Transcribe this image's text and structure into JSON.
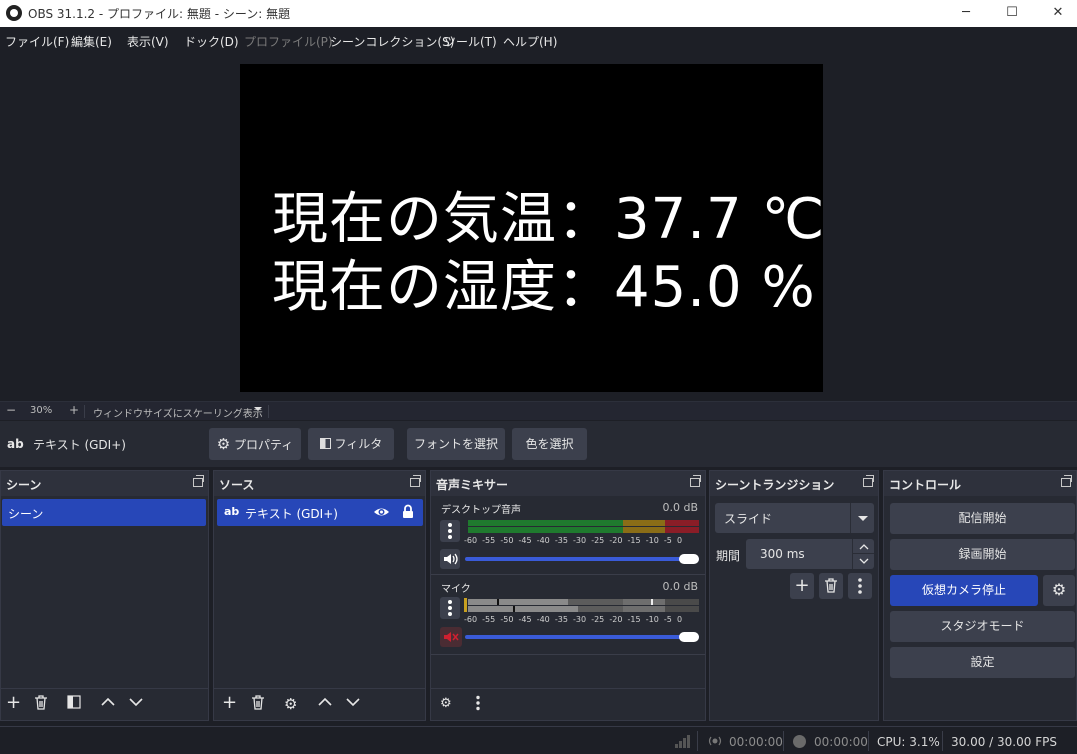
{
  "window": {
    "title": "OBS 31.1.2 - プロファイル: 無題 - シーン: 無題",
    "minimize": "─",
    "maximize": "☐",
    "close": "✕"
  },
  "menu": [
    "ファイル(F)",
    "編集(E)",
    "表示(V)",
    "ドック(D)",
    "プロファイル(P)",
    "シーンコレクション(S)",
    "ツール(T)",
    "ヘルプ(H)"
  ],
  "menu_disabled": [
    false,
    false,
    false,
    false,
    true,
    false,
    false,
    false
  ],
  "preview": {
    "line1": "現在の気温：37.7 ℃",
    "line2": "現在の湿度：45.0 %"
  },
  "zoom": {
    "minus": "−",
    "level": "30%",
    "plus": "+",
    "scaling_label": "ウィンドウサイズにスケーリング表示"
  },
  "source_toolbar": {
    "source_icon": "ab",
    "source_name": "テキスト (GDI+)",
    "properties": "プロパティ",
    "filters": "フィルタ",
    "select_font": "フォントを選択",
    "select_color": "色を選択"
  },
  "scenes": {
    "title": "シーン",
    "items": [
      "シーン"
    ]
  },
  "sources": {
    "title": "ソース",
    "items": [
      {
        "icon": "ab",
        "name": "テキスト (GDI+)"
      }
    ]
  },
  "mixer": {
    "title": "音声ミキサー",
    "scale": [
      "-60",
      "-55",
      "-50",
      "-45",
      "-40",
      "-35",
      "-30",
      "-25",
      "-20",
      "-15",
      "-10",
      "-5",
      "0"
    ],
    "channels": [
      {
        "name": "デスクトップ音声",
        "db": "0.0 dB",
        "muted": false,
        "volume": 1.0
      },
      {
        "name": "マイク",
        "db": "0.0 dB",
        "muted": true,
        "volume": 1.0
      }
    ]
  },
  "transitions": {
    "title": "シーントランジション",
    "selected": "スライド",
    "duration_label": "期間",
    "duration_value": "300 ms"
  },
  "controls": {
    "title": "コントロール",
    "start_streaming": "配信開始",
    "start_recording": "録画開始",
    "virtual_cam": "仮想カメラ停止",
    "studio_mode": "スタジオモード",
    "settings": "設定"
  },
  "status": {
    "stream_time": "00:00:00",
    "rec_time": "00:00:00",
    "cpu": "CPU: 3.1%",
    "fps": "30.00 / 30.00 FPS"
  },
  "colors": {
    "accent": "#2747b8",
    "panel": "#272a33",
    "background": "#1d1f26",
    "button": "#3c404d",
    "meter_green": "#1f7a2e",
    "meter_yellow": "#8a6d17",
    "meter_red": "#8a1d27",
    "mute_red": "#c02030"
  }
}
